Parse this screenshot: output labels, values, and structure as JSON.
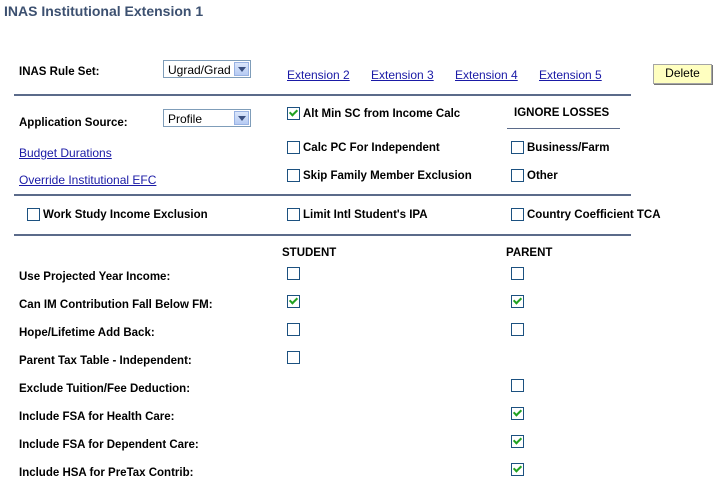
{
  "page_title": "INAS Institutional Extension 1",
  "rule_set": {
    "label": "INAS Rule Set:",
    "value": "Ugrad/Grad"
  },
  "extensions": [
    "Extension 2",
    "Extension 3",
    "Extension 4",
    "Extension 5"
  ],
  "delete_label": "Delete",
  "app_source": {
    "label": "Application Source:",
    "value": "Profile"
  },
  "links": {
    "budget": "Budget Durations",
    "override": "Override Institutional EFC"
  },
  "options": {
    "alt_min_sc": {
      "label": "Alt Min SC from Income Calc",
      "checked": true
    },
    "calc_pc": {
      "label": "Calc PC For Independent",
      "checked": false
    },
    "skip_family": {
      "label": "Skip Family Member Exclusion",
      "checked": false
    },
    "work_study": {
      "label": "Work Study Income Exclusion",
      "checked": false
    },
    "limit_intl": {
      "label": "Limit Intl Student's IPA",
      "checked": false
    },
    "country_coeff": {
      "label": "Country Coefficient TCA",
      "checked": false
    }
  },
  "ignore_losses": {
    "heading": "IGNORE LOSSES",
    "business": {
      "label": "Business/Farm",
      "checked": false
    },
    "other": {
      "label": "Other",
      "checked": false
    }
  },
  "columns": {
    "student": "STUDENT",
    "parent": "PARENT"
  },
  "rows": [
    {
      "label": "Use Projected Year Income:",
      "student": false,
      "parent": false
    },
    {
      "label": "Can IM Contribution Fall Below FM:",
      "student": true,
      "parent": true
    },
    {
      "label": "Hope/Lifetime Add Back:",
      "student": false,
      "parent": false
    },
    {
      "label": "Parent Tax Table - Independent:",
      "student": false,
      "parent": null
    },
    {
      "label": "Exclude Tuition/Fee Deduction:",
      "student": null,
      "parent": false
    },
    {
      "label": "Include FSA for Health Care:",
      "student": null,
      "parent": true
    },
    {
      "label": "Include FSA for Dependent Care:",
      "student": null,
      "parent": true
    },
    {
      "label": "Include HSA for PreTax Contrib:",
      "student": null,
      "parent": true
    }
  ]
}
